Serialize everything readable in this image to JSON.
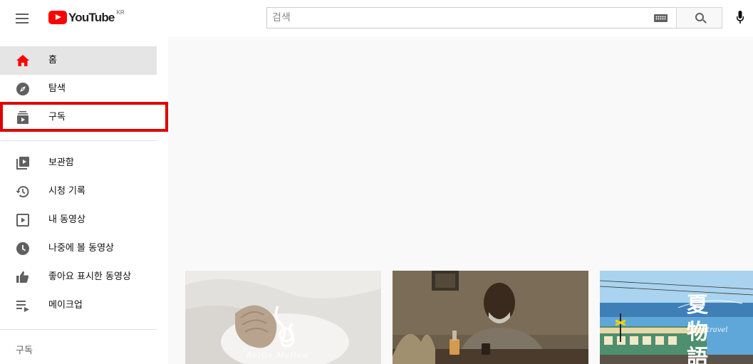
{
  "header": {
    "logo_text": "YouTube",
    "region": "KR",
    "search_placeholder": "검색"
  },
  "sidebar": {
    "primary": [
      {
        "label": "홈",
        "icon": "home-icon",
        "active": true
      },
      {
        "label": "탐색",
        "icon": "explore-icon"
      },
      {
        "label": "구독",
        "icon": "subscriptions-icon",
        "highlighted": true
      }
    ],
    "library": [
      {
        "label": "보관함",
        "icon": "library-icon"
      },
      {
        "label": "시청 기록",
        "icon": "history-icon"
      },
      {
        "label": "내 동영상",
        "icon": "my-videos-icon"
      },
      {
        "label": "나중에 볼 동영상",
        "icon": "watch-later-icon"
      },
      {
        "label": "좋아요 표시한 동영상",
        "icon": "liked-icon"
      },
      {
        "label": "메이크업",
        "icon": "playlist-icon"
      }
    ],
    "subscriptions_title": "구독"
  },
  "colors": {
    "brand_red": "#ff0000",
    "highlight_red": "#e00000",
    "active_bg": "#e5e5e5"
  }
}
